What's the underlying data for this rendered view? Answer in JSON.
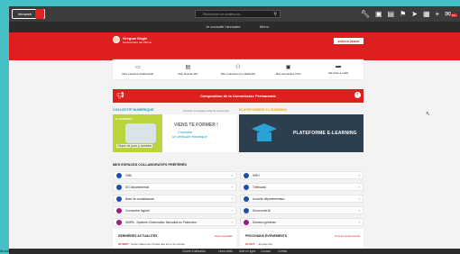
{
  "topbar": {
    "logo_text": "Intraweb",
    "search_placeholder": "Rechercher un contenu du...",
    "icons": [
      "wrench-icon",
      "lock-icon",
      "save-icon",
      "location-icon",
      "send-icon",
      "grid-icon",
      "plus-icon",
      "mail-icon"
    ],
    "mail_badge": "99+"
  },
  "menu": {
    "item1": "Je consulte l'annuaire",
    "item2": "Menu"
  },
  "user": {
    "name": "Gregow Gogle",
    "profile": "Gestionnaire par Pliume"
  },
  "espace_button": "ESPACE PERSO",
  "tiles": [
    {
      "icon": "spaces-icon",
      "label": "Mes espaces collaboratifs"
    },
    {
      "icon": "folder-icon",
      "label": "Mon Dossier RH"
    },
    {
      "icon": "users-icon",
      "label": "Mes entretiens pro (EIA)LEA"
    },
    {
      "icon": "request-icon",
      "label": "Mes demandes CSG"
    },
    {
      "icon": "toolbox-icon",
      "label": "Ma boîte à outils"
    }
  ],
  "banner": {
    "text": "Composition de la Commission Permanente"
  },
  "collectif": {
    "title": "COLLECTIF NUMÉRIQUE",
    "sub": "Accéder à l'espace collectif numérique"
  },
  "elearning": {
    "title": "PLATEFORMES E-LEARNING",
    "image_text": "PLATEFORME E-LEARNING"
  },
  "promo": {
    "headline": "VIENS TE FORMER !",
    "sub1": "Conduire",
    "sub2": "un véhicule électrique",
    "tag": "Clique ici pour y accéder",
    "badge": "E-LEARNING"
  },
  "spaces": {
    "title": "MES ESPACES COLLABORATIFS PRÉFÉRÉS",
    "left": [
      {
        "label": "2050",
        "color": "#1d4fa8"
      },
      {
        "label": "DG départemental",
        "color": "#1d4fa8"
      },
      {
        "label": "Base de connaissance",
        "color": "#1d4fa8"
      },
      {
        "label": "Conception logiciel",
        "color": "#a1197e"
      },
      {
        "label": "SIMPA - Système d'Information Mutualisé du Patrimoine",
        "color": "#a1197e"
      }
    ],
    "right": [
      {
        "label": "SIRH",
        "color": "#1d4fa8"
      },
      {
        "label": "Télétravail",
        "color": "#1d4fa8"
      },
      {
        "label": "Accueils départementaux",
        "color": "#1d4fa8"
      },
      {
        "label": "Déconomie18",
        "color": "#1d4fa8"
      },
      {
        "label": "Direction générale",
        "color": "#a1197e"
      }
    ]
  },
  "news": {
    "title": "DERNIÈRES ACTUALITÉS",
    "see_all": "Toute l'actualité",
    "date": "30 SEPT",
    "text": "Sortie Nature de l'Amitié des 10 et 11 octobre"
  },
  "events": {
    "title": "PROCHAINS ÉVÉNEMENTS",
    "see_all": "Tous les événements",
    "date": "01 OCT",
    "text": "Journée Ple"
  },
  "footer": [
    "Charte d'utilisation",
    "Liens utiles",
    "Aide en ligne",
    "Contact",
    "Crédits"
  ],
  "edge_label": "Mozilla"
}
